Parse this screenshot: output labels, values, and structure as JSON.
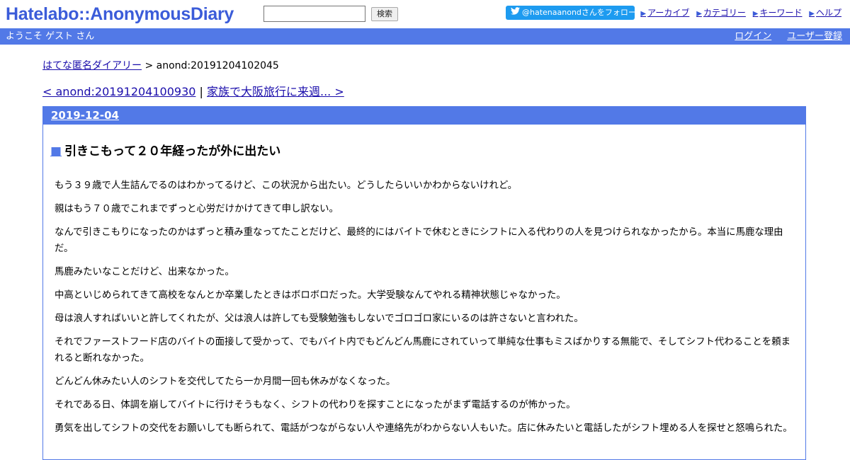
{
  "header": {
    "logo": "Hatelabo::AnonymousDiary",
    "search_value": "",
    "search_button": "検索",
    "follow_label": "@hatenaanondさんをフォロー",
    "nav": [
      "アーカイブ",
      "カテゴリー",
      "キーワード",
      "ヘルプ"
    ]
  },
  "bar": {
    "welcome": "ようこそ ゲスト さん",
    "login": "ログイン",
    "register": "ユーザー登録"
  },
  "breadcrumb": {
    "home": "はてな匿名ダイアリー",
    "sep": " > ",
    "current": "anond:20191204102045"
  },
  "pager": {
    "prev": "< anond:20191204100930",
    "sep": " | ",
    "next": "家族で大阪旅行に来週... >"
  },
  "day": {
    "date": "2019-12-04",
    "title_marker": "■",
    "title": "引きこもって２０年経ったが外に出たい",
    "paragraphs": [
      "もう３９歳で人生詰んでるのはわかってるけど、この状況から出たい。どうしたらいいかわからないけれど。",
      "親はもう７０歳でこれまでずっと心労だけかけてきて申し訳ない。",
      "なんで引きこもりになったのかはずっと積み重なってたことだけど、最終的にはバイトで休むときにシフトに入る代わりの人を見つけられなかったから。本当に馬鹿な理由だ。",
      "馬鹿みたいなことだけど、出来なかった。",
      "中高といじめられてきて高校をなんとか卒業したときはボロボロだった。大学受験なんてやれる精神状態じゃなかった。",
      "母は浪人すればいいと許してくれたが、父は浪人は許しても受験勉強もしないでゴロゴロ家にいるのは許さないと言われた。",
      "それでファーストフード店のバイトの面接して受かって、でもバイト内でもどんどん馬鹿にされていって単純な仕事もミスばかりする無能で、そしてシフト代わることを頼まれると断れなかった。",
      "どんどん休みたい人のシフトを交代してたら一か月間一回も休みがなくなった。",
      "それである日、体調を崩してバイトに行けそうもなく、シフトの代わりを探すことになったがまず電話するのが怖かった。",
      "勇気を出してシフトの交代をお願いしても断られて、電話がつながらない人や連絡先がわからない人もいた。店に休みたいと電話したがシフト埋める人を探せと怒鳴られた。"
    ]
  },
  "colors": {
    "brand_blue": "#5279e7",
    "logo_blue": "#3b5cd9",
    "twitter_blue": "#1d9bf0"
  }
}
